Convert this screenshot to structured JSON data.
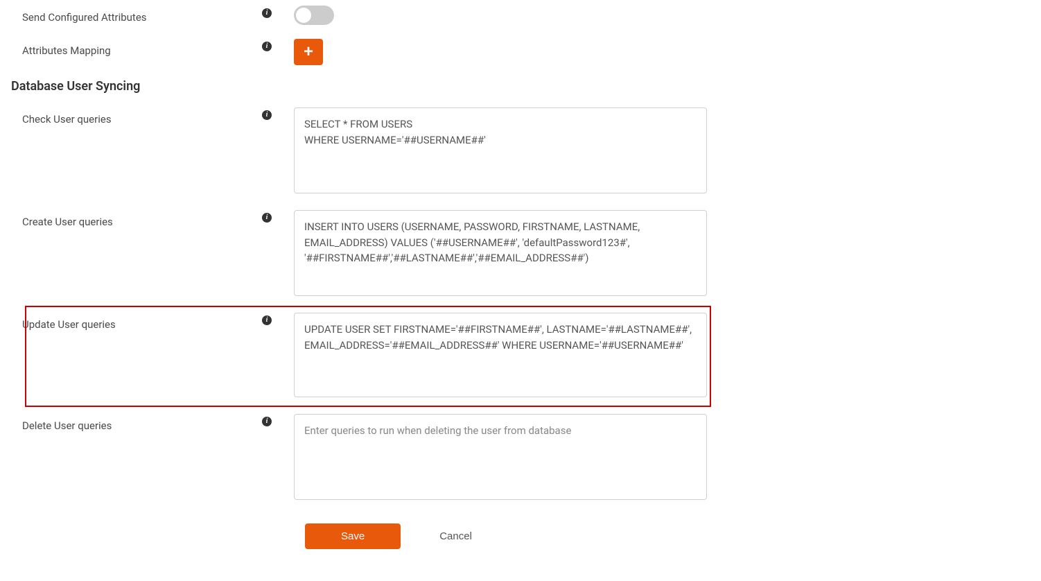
{
  "fields": {
    "sendConfiguredAttributes": {
      "label": "Send Configured Attributes"
    },
    "attributesMapping": {
      "label": "Attributes Mapping"
    },
    "sectionHeading": "Database User Syncing",
    "checkUserQueries": {
      "label": "Check User queries",
      "value": "SELECT * FROM USERS\nWHERE USERNAME='##USERNAME##'"
    },
    "createUserQueries": {
      "label": "Create User queries",
      "value": "INSERT INTO USERS (USERNAME, PASSWORD, FIRSTNAME, LASTNAME, EMAIL_ADDRESS) VALUES ('##USERNAME##', 'defaultPassword123#', '##FIRSTNAME##','##LASTNAME##','##EMAIL_ADDRESS##')"
    },
    "updateUserQueries": {
      "label": "Update User queries",
      "value": "UPDATE USER SET FIRSTNAME='##FIRSTNAME##', LASTNAME='##LASTNAME##', EMAIL_ADDRESS='##EMAIL_ADDRESS##' WHERE USERNAME='##USERNAME##'"
    },
    "deleteUserQueries": {
      "label": "Delete User queries",
      "placeholder": "Enter queries to run when deleting the user from database"
    }
  },
  "buttons": {
    "save": "Save",
    "cancel": "Cancel"
  },
  "icons": {
    "info": "i",
    "plus": "+"
  }
}
